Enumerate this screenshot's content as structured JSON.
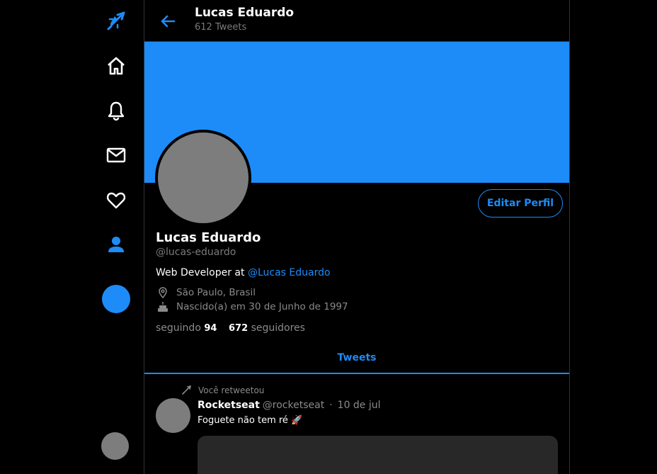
{
  "header": {
    "name": "Lucas Eduardo",
    "tweet_count": "612 Tweets"
  },
  "profile": {
    "edit_button": "Editar Perfil",
    "name": "Lucas Eduardo",
    "handle": "@lucas-eduardo",
    "bio_text": "Web Developer at ",
    "bio_link": "@Lucas Eduardo",
    "location": "São Paulo, Brasil",
    "birthday": "Nascido(a) em 30 de Junho de 1997",
    "following_label": "seguindo",
    "following_count": "94",
    "followers_count": "672",
    "followers_label": "seguidores"
  },
  "tabs": [
    {
      "label": "Tweets",
      "active": true
    }
  ],
  "tweet": {
    "retweet_label": "Você retweetou",
    "author_name": "Rocketseat",
    "author_handle": "@rocketseat",
    "separator": "·",
    "date": "10 de jul",
    "text": "Foguete não tem ré 🚀"
  },
  "sidebar": {
    "icons": [
      "rocket-logo-icon",
      "home-icon",
      "bell-icon",
      "mail-icon",
      "heart-icon",
      "person-icon"
    ]
  },
  "colors": {
    "accent": "#1d8cf8",
    "background": "#000000",
    "muted": "#7a7a7a",
    "avatar_placeholder": "#7d7d7d",
    "media_placeholder": "#282828"
  }
}
